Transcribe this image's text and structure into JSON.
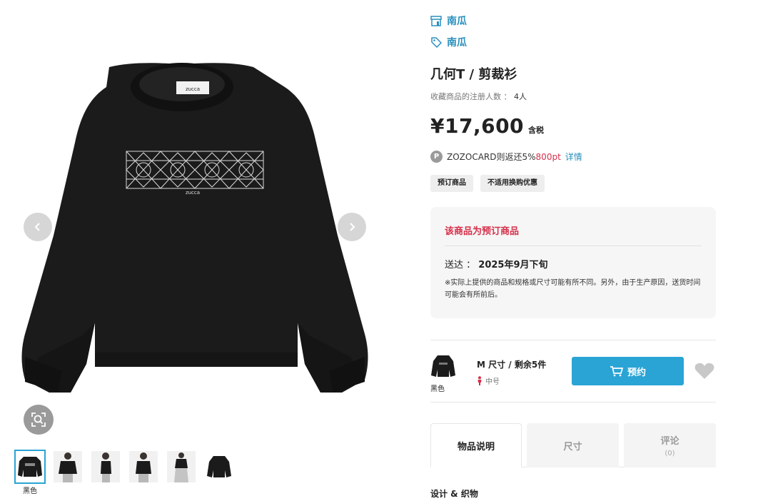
{
  "gallery": {
    "main_image": "black crew-neck long-sleeve sweatshirt with geometric print",
    "thumbnails": [
      {
        "label": "黑色",
        "active": true
      },
      {
        "label": "",
        "active": false
      },
      {
        "label": "",
        "active": false
      },
      {
        "label": "",
        "active": false
      },
      {
        "label": "",
        "active": false
      },
      {
        "label": "",
        "active": false
      }
    ],
    "icons": {
      "prev": "chevron-left-icon",
      "next": "chevron-right-icon",
      "zoom": "zoom-search-icon"
    }
  },
  "brand": {
    "shop_name": "南瓜",
    "brand_name": "南瓜",
    "shop_icon": "shop-icon",
    "brand_icon": "tag-icon"
  },
  "product": {
    "title": "几何T / 剪裁衫",
    "favorite_label": "收藏商品的注册人数 ：",
    "favorite_count": "4人",
    "price": "¥17,600",
    "tax_label": "含税",
    "points_badge": "P",
    "points_text": "ZOZOCARD则返还5%",
    "points_value": "800pt",
    "points_detail": "详情",
    "tags": [
      "预订商品",
      "不适用换购优惠"
    ]
  },
  "notice": {
    "title": "该商品为预订商品",
    "ship_label": "送达 ：",
    "ship_value": "2025年9月下旬",
    "note": "※实际上提供的商品和规格或尺寸可能有所不同。另外，由于生产原因，送货时间可能会有所前后。"
  },
  "variant": {
    "color": "黑色",
    "size_text": "M 尺寸 / 剩余5件",
    "size_sub": "中号",
    "reserve_label": "预约",
    "cart_icon": "cart-icon",
    "heart_icon": "heart-icon"
  },
  "tabs": {
    "description": "物品说明",
    "size": "尺寸",
    "review": "评论",
    "review_count": "(0)"
  },
  "section": {
    "design_title": "设计 & 织物"
  },
  "colors": {
    "accent_blue": "#2aa4d5",
    "link_blue": "#2a8fbd",
    "alert_red": "#d6304b"
  }
}
